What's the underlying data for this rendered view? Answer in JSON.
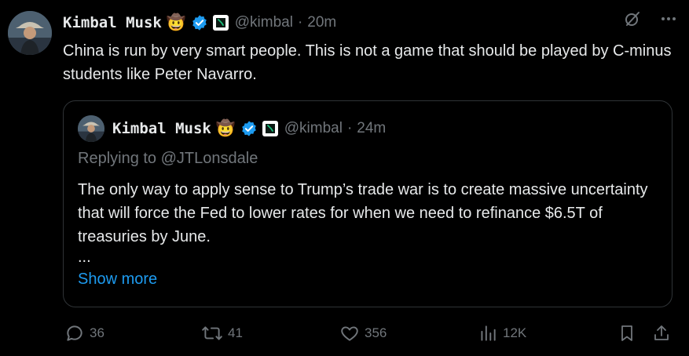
{
  "author": {
    "name": "Kimbal Musk",
    "emoji": "🤠",
    "handle": "@kimbal",
    "separator": "·",
    "time": "20m"
  },
  "tweet": {
    "text": "China is run by very smart people. This is not a game that should be played by C-minus students like Peter Navarro."
  },
  "quote": {
    "name": "Kimbal Musk",
    "emoji": "🤠",
    "handle": "@kimbal",
    "separator": "·",
    "time": "24m",
    "replying_to": "Replying to @JTLonsdale",
    "text": "The only way to apply sense to Trump’s trade war is to create massive uncertainty that will force the Fed to lower rates for when we need to refinance $6.5T of treasuries by June.",
    "ellipsis": "...",
    "show_more": "Show more"
  },
  "actions": {
    "replies": "36",
    "reposts": "41",
    "likes": "356",
    "views": "12K"
  },
  "icons": {
    "verified": "verified-badge-icon",
    "affiliate": "affiliate-badge-icon",
    "grok": "grok-icon",
    "more": "more-icon",
    "reply": "reply-icon",
    "repost": "repost-icon",
    "like": "heart-icon",
    "views": "views-icon",
    "bookmark": "bookmark-icon",
    "share": "share-icon"
  },
  "colors": {
    "background": "#000000",
    "text": "#e7e9ea",
    "muted": "#71767b",
    "link": "#1d9bf0",
    "verified": "#1d9bf0",
    "border": "#2f3336"
  }
}
